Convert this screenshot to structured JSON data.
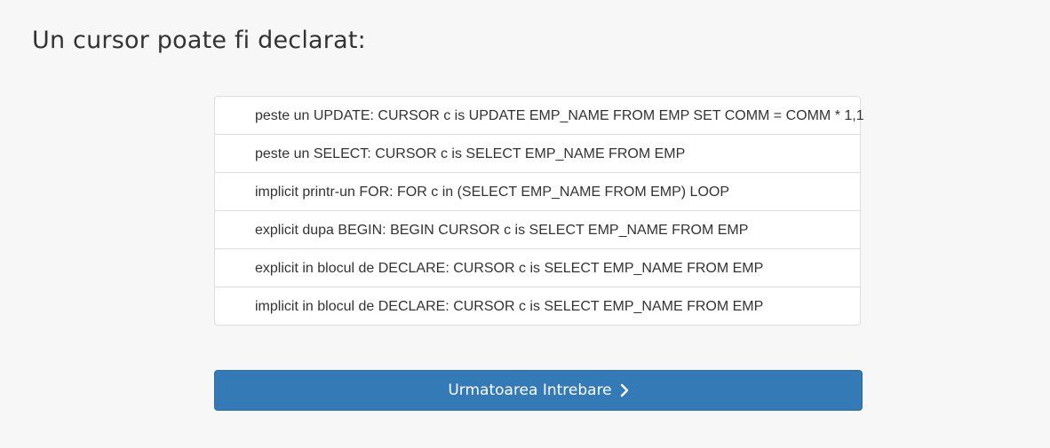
{
  "question": {
    "title": "Un cursor poate fi declarat:"
  },
  "answers": [
    "peste un UPDATE: CURSOR c is UPDATE EMP_NAME FROM EMP SET COMM = COMM * 1,1",
    "peste un SELECT: CURSOR c is SELECT EMP_NAME FROM EMP",
    "implicit printr-un FOR: FOR c in (SELECT EMP_NAME FROM EMP) LOOP",
    "explicit dupa BEGIN: BEGIN CURSOR c is SELECT EMP_NAME FROM EMP",
    "explicit in blocul de DECLARE: CURSOR c is SELECT EMP_NAME FROM EMP",
    "implicit in blocul de DECLARE: CURSOR c is SELECT EMP_NAME FROM EMP"
  ],
  "next_button": {
    "label": "Urmatoarea Intrebare",
    "icon": "chevron-right-icon"
  },
  "colors": {
    "background": "#f7f7f7",
    "button": "#337ab7",
    "text": "#333333",
    "border": "#dddddd"
  }
}
